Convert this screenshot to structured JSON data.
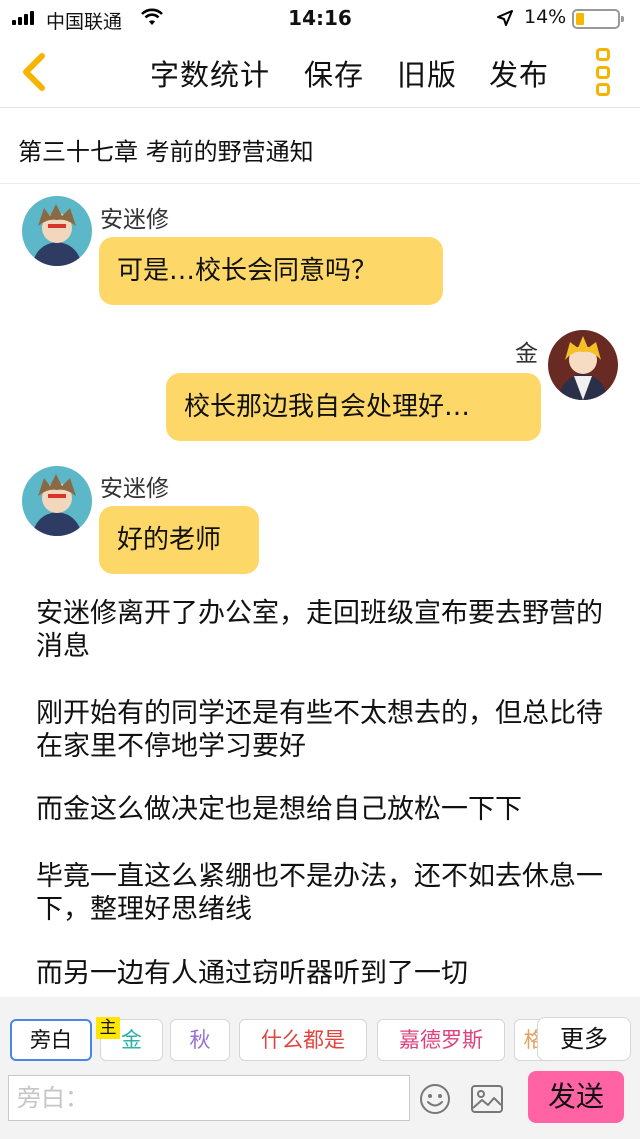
{
  "status_bar": {
    "carrier": "中国联通",
    "time": "14:16",
    "battery": "14%"
  },
  "toolbar": {
    "back_icon": "chevron-left-icon",
    "word_count": "字数统计",
    "save": "保存",
    "old_version": "旧版",
    "publish": "发布",
    "more_icon": "vertical-dots-icon",
    "accent_color": "#f4b400"
  },
  "chapter": {
    "title": "第三十七章 考前的野营通知"
  },
  "messages": [
    {
      "speaker": "安迷修",
      "text": "可是…校长会同意吗？",
      "side": "left"
    },
    {
      "speaker": "金",
      "text": "校长那边我自会处理好…",
      "side": "right"
    },
    {
      "speaker": "安迷修",
      "text": "好的老师",
      "side": "left"
    }
  ],
  "narration": [
    "安迷修离开了办公室，走回班级宣布要去野营的消息",
    "刚开始有的同学还是有些不太想去的，但总比待在家里不停地学习要好",
    "而金这么做决定也是想给自己放松一下下",
    "毕竟一直这么紧绷也不是办法，还不如去休息一下，整理好思绪线",
    "而另一边有人通过窃听器听到了一切"
  ],
  "roles": {
    "chips": [
      {
        "label": "旁白",
        "color": "#111111"
      },
      {
        "label": "金",
        "color": "#2bb3a9"
      },
      {
        "label": "秋",
        "color": "#9b6fd6"
      },
      {
        "label": "什么都是",
        "color": "#e0433f"
      },
      {
        "label": "嘉德罗斯",
        "color": "#e0417d"
      },
      {
        "label": "格",
        "color": "#e8a060"
      }
    ],
    "main_tag": "主",
    "more": "更多"
  },
  "input": {
    "placeholder": "旁白：",
    "emoji_icon": "smiley-icon",
    "image_icon": "image-icon",
    "send": "发送",
    "send_color": "#ff63a3"
  },
  "colors": {
    "bubble": "#fdd868"
  }
}
